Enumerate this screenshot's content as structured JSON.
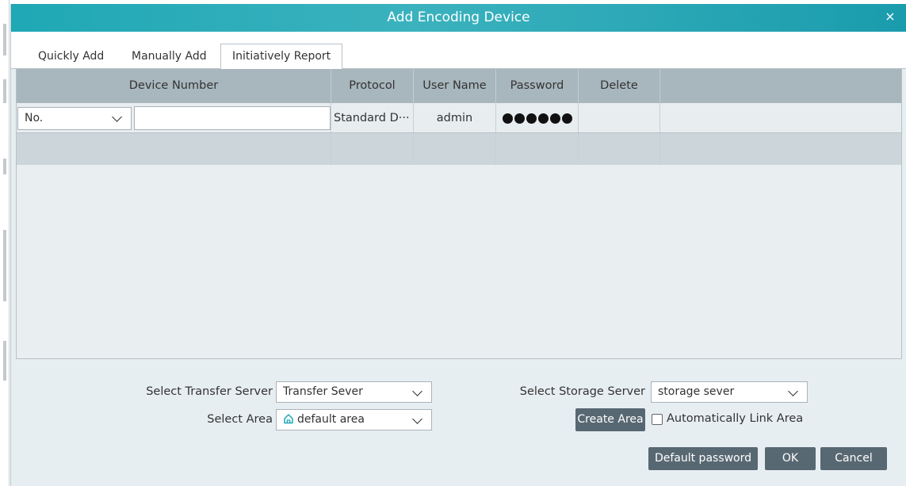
{
  "dialog": {
    "title": "Add Encoding Device",
    "close_symbol": "×"
  },
  "tabs": [
    {
      "label": "Quickly Add",
      "active": false
    },
    {
      "label": "Manually Add",
      "active": false
    },
    {
      "label": "Initiatively Report",
      "active": true
    }
  ],
  "table": {
    "headers": [
      "Device Number",
      "Protocol",
      "User Name",
      "Password",
      "Delete"
    ],
    "row": {
      "number_type": "No.",
      "device_number": "",
      "protocol": "Standard D···",
      "user_name": "admin",
      "password_dots": 6
    }
  },
  "footer": {
    "transfer_label": "Select Transfer Server",
    "transfer_value": "Transfer Sever",
    "storage_label": "Select Storage Server",
    "storage_value": "storage sever",
    "area_label": "Select Area",
    "area_value": "default area",
    "create_area": "Create Area",
    "auto_link": "Automatically Link Area",
    "auto_link_checked": false,
    "default_password": "Default password",
    "ok": "OK",
    "cancel": "Cancel"
  },
  "colors": {
    "titlebar": "#1fa8b5",
    "header_row": "#a8b6bd",
    "button": "#586872",
    "area_icon": "#1fa8b5"
  }
}
